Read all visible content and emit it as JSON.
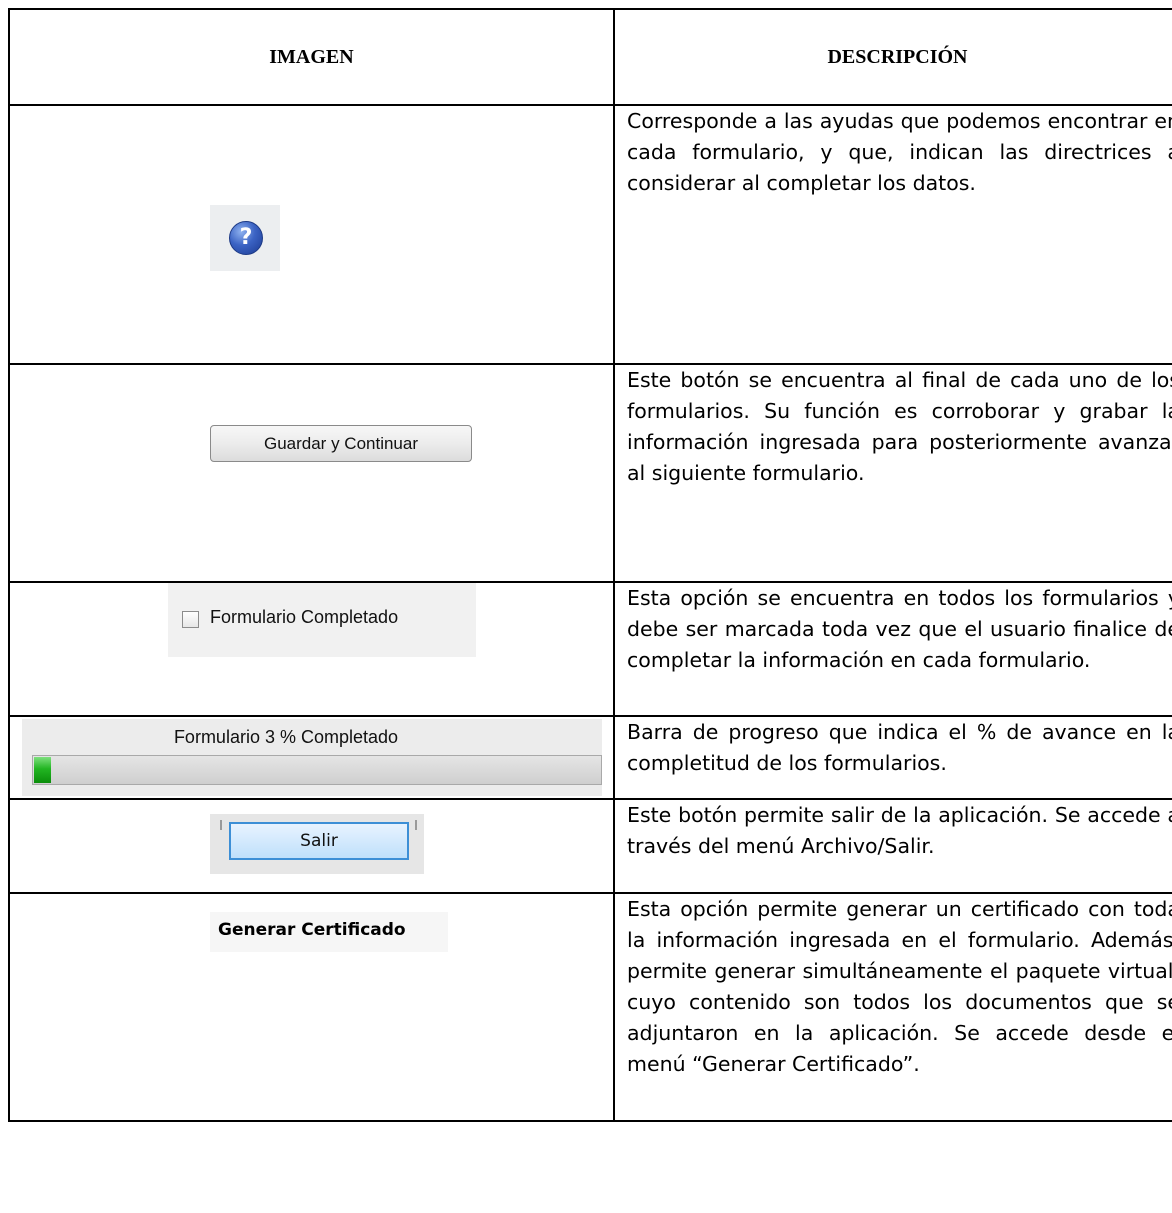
{
  "header": {
    "col_image": "IMAGEN",
    "col_description": "DESCRIPCIÓN"
  },
  "rows": [
    {
      "image": {
        "type": "help-icon",
        "glyph": "?"
      },
      "description": "Corresponde a las ayudas que podemos encontrar en cada formulario, y que, indican las directrices a considerar al completar los datos."
    },
    {
      "image": {
        "type": "button",
        "label": "Guardar y Continuar"
      },
      "description": "Este botón se encuentra al final de cada uno de los formularios. Su función es corroborar y grabar la información ingresada para posteriormente avanzar al siguiente formulario."
    },
    {
      "image": {
        "type": "checkbox",
        "label": "Formulario Completado",
        "checked": false
      },
      "description": "Esta opción se encuentra en todos los formularios y debe ser marcada toda vez que el usuario finalice de completar la información en cada formulario."
    },
    {
      "image": {
        "type": "progress-bar",
        "label": "Formulario 3 % Completado",
        "percent": 3
      },
      "description": "Barra de progreso que indica el % de avance en la completitud de los formularios."
    },
    {
      "image": {
        "type": "button",
        "label": "Salir"
      },
      "description": "Este botón permite salir de la aplicación. Se accede a través del menú Archivo/Salir."
    },
    {
      "image": {
        "type": "menu-item",
        "label": "Generar Certificado"
      },
      "description": "Esta opción permite generar un certificado con toda la información ingresada en el formulario. Además, permite generar simultáneamente el paquete virtual, cuyo contenido son todos los documentos que se adjuntaron en la aplicación. Se accede desde el menú “Generar Certificado”."
    }
  ]
}
